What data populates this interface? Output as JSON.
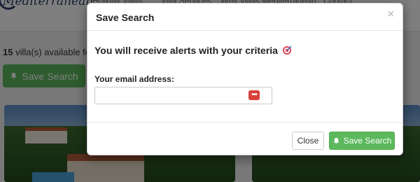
{
  "background": {
    "logo_text": "Mediterranean",
    "nav": [
      "Holiday Villas",
      "Villa Services",
      "Why Villas Mediterranean",
      "Contact"
    ],
    "results": {
      "count": "15",
      "text": "villa(s) available fo"
    },
    "save_button_label": "Save Search"
  },
  "modal": {
    "title": "Save Search",
    "close_glyph": "×",
    "alert_text": "You will receive alerts with your criteria",
    "email_label": "Your email address:",
    "email_value": "",
    "password_manager_glyph": "•••",
    "buttons": {
      "close": "Close",
      "save": "Save Search"
    }
  },
  "colors": {
    "success": "#5cb85c",
    "password_icon": "#d9403a",
    "logo": "#2b3f66"
  }
}
